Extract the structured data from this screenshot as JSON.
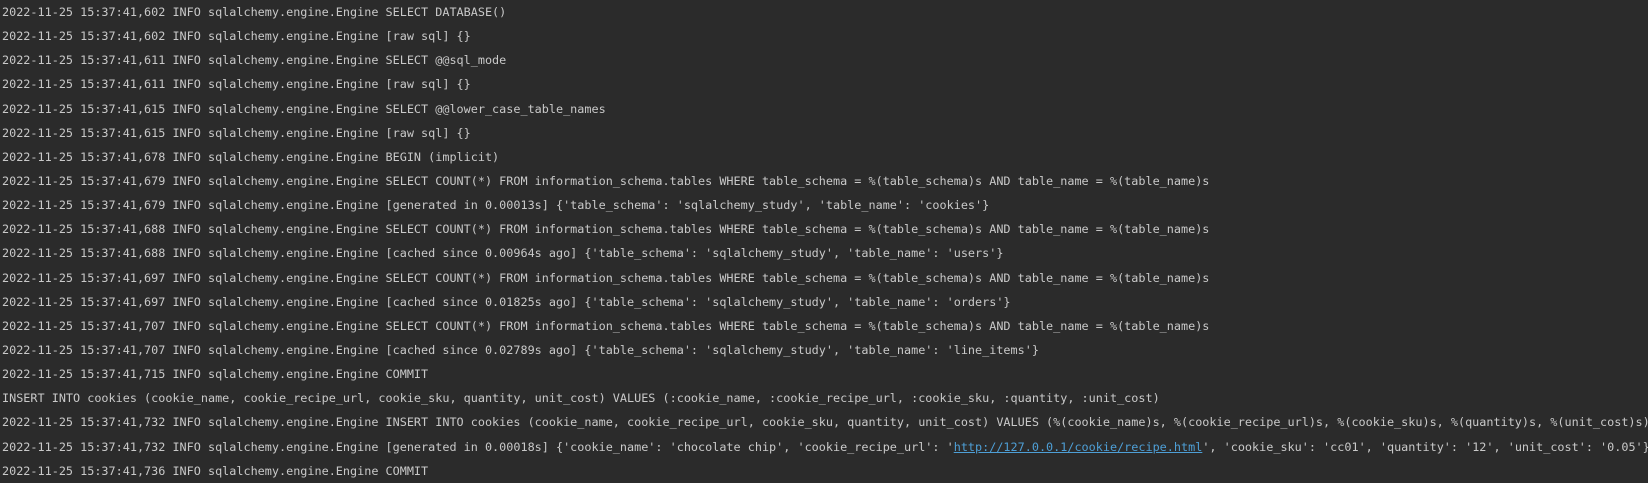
{
  "console": {
    "lines": [
      "2022-11-25 15:37:41,602 INFO sqlalchemy.engine.Engine SELECT DATABASE()",
      "2022-11-25 15:37:41,602 INFO sqlalchemy.engine.Engine [raw sql] {}",
      "2022-11-25 15:37:41,611 INFO sqlalchemy.engine.Engine SELECT @@sql_mode",
      "2022-11-25 15:37:41,611 INFO sqlalchemy.engine.Engine [raw sql] {}",
      "2022-11-25 15:37:41,615 INFO sqlalchemy.engine.Engine SELECT @@lower_case_table_names",
      "2022-11-25 15:37:41,615 INFO sqlalchemy.engine.Engine [raw sql] {}",
      "2022-11-25 15:37:41,678 INFO sqlalchemy.engine.Engine BEGIN (implicit)",
      "2022-11-25 15:37:41,679 INFO sqlalchemy.engine.Engine SELECT COUNT(*) FROM information_schema.tables WHERE table_schema = %(table_schema)s AND table_name = %(table_name)s",
      "2022-11-25 15:37:41,679 INFO sqlalchemy.engine.Engine [generated in 0.00013s] {'table_schema': 'sqlalchemy_study', 'table_name': 'cookies'}",
      "2022-11-25 15:37:41,688 INFO sqlalchemy.engine.Engine SELECT COUNT(*) FROM information_schema.tables WHERE table_schema = %(table_schema)s AND table_name = %(table_name)s",
      "2022-11-25 15:37:41,688 INFO sqlalchemy.engine.Engine [cached since 0.00964s ago] {'table_schema': 'sqlalchemy_study', 'table_name': 'users'}",
      "2022-11-25 15:37:41,697 INFO sqlalchemy.engine.Engine SELECT COUNT(*) FROM information_schema.tables WHERE table_schema = %(table_schema)s AND table_name = %(table_name)s",
      "2022-11-25 15:37:41,697 INFO sqlalchemy.engine.Engine [cached since 0.01825s ago] {'table_schema': 'sqlalchemy_study', 'table_name': 'orders'}",
      "2022-11-25 15:37:41,707 INFO sqlalchemy.engine.Engine SELECT COUNT(*) FROM information_schema.tables WHERE table_schema = %(table_schema)s AND table_name = %(table_name)s",
      "2022-11-25 15:37:41,707 INFO sqlalchemy.engine.Engine [cached since 0.02789s ago] {'table_schema': 'sqlalchemy_study', 'table_name': 'line_items'}",
      "2022-11-25 15:37:41,715 INFO sqlalchemy.engine.Engine COMMIT",
      "INSERT INTO cookies (cookie_name, cookie_recipe_url, cookie_sku, quantity, unit_cost) VALUES (:cookie_name, :cookie_recipe_url, :cookie_sku, :quantity, :unit_cost)",
      "2022-11-25 15:37:41,732 INFO sqlalchemy.engine.Engine INSERT INTO cookies (cookie_name, cookie_recipe_url, cookie_sku, quantity, unit_cost) VALUES (%(cookie_name)s, %(cookie_recipe_url)s, %(cookie_sku)s, %(quantity)s, %(unit_cost)s)"
    ],
    "link_line": {
      "before": "2022-11-25 15:37:41,732 INFO sqlalchemy.engine.Engine [generated in 0.00018s] {'cookie_name': 'chocolate chip', 'cookie_recipe_url': '",
      "link": "http://127.0.0.1/cookie/recipe.html",
      "after": "', 'cookie_sku': 'cc01', 'quantity': '12', 'unit_cost': '0.05'}"
    },
    "last_line": "2022-11-25 15:37:41,736 INFO sqlalchemy.engine.Engine COMMIT"
  }
}
